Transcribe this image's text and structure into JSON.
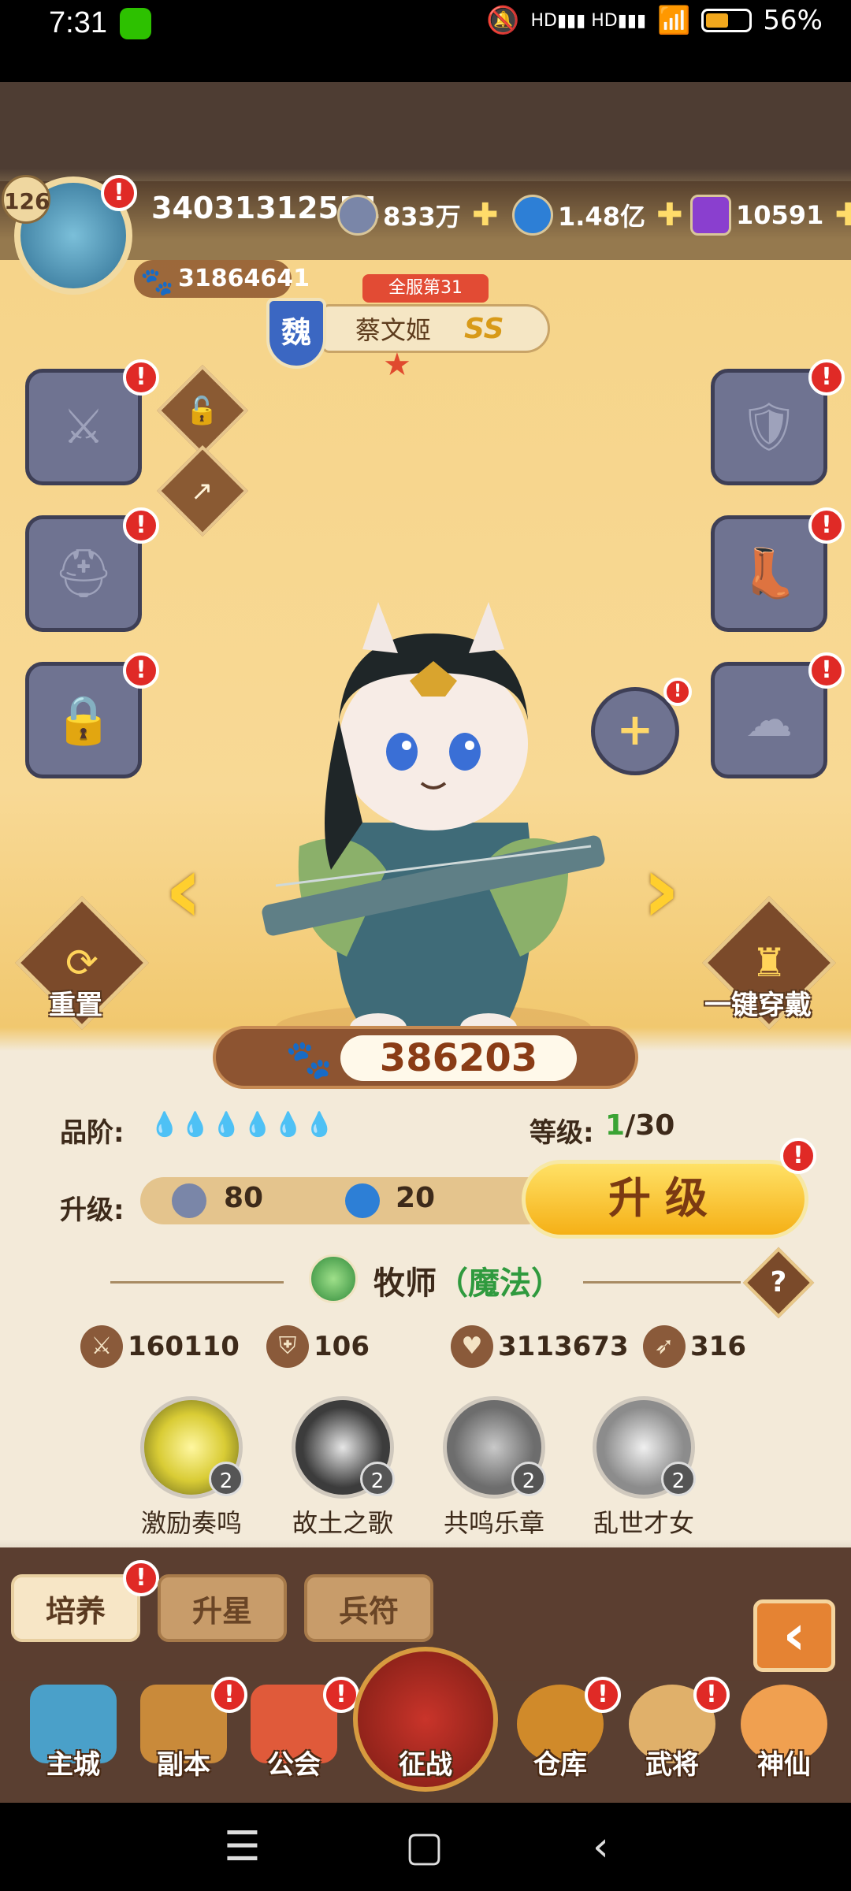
{
  "status_bar": {
    "time": "7:31",
    "battery": "56%",
    "signal": "HD▮▮▮ HD▮▮▮"
  },
  "player": {
    "level": "126",
    "id": "34031312551",
    "power": "31864641"
  },
  "resources": [
    {
      "name": "coin",
      "value": "833万",
      "color": "#7a86a8"
    },
    {
      "name": "gem",
      "value": "1.48亿",
      "color": "#2d7fd6"
    },
    {
      "name": "crystal",
      "value": "10591",
      "color": "#8a3fcf"
    }
  ],
  "hero": {
    "rank": "全服第31",
    "faction": "魏",
    "name": "蔡文姬",
    "grade": "SS",
    "power": "386203"
  },
  "actions": {
    "reset": "重置",
    "equip_all": "一键穿戴"
  },
  "stats_panel": {
    "quality_label": "品阶:",
    "quality_drops": "💧💧💧💧💧💧",
    "level_label": "等级:",
    "level_current": "1",
    "level_max": "/30",
    "upgrade_label": "升级:",
    "cost_coin": "80",
    "cost_gem": "20",
    "upgrade_button": "升级"
  },
  "class": {
    "name": "牧师",
    "type": "（魔法）"
  },
  "stats": [
    {
      "icon": "sword-icon",
      "glyph": "⚔",
      "value": "160110"
    },
    {
      "icon": "shield-icon",
      "glyph": "⛨",
      "value": "106"
    },
    {
      "icon": "heart-icon",
      "glyph": "♥",
      "value": "3113673"
    },
    {
      "icon": "boot-icon",
      "glyph": "➶",
      "value": "316"
    }
  ],
  "skills": [
    {
      "name": "激励奏鸣",
      "level": "2",
      "color": "#d9cc35"
    },
    {
      "name": "故土之歌",
      "level": "2",
      "color": "#3c3c3c"
    },
    {
      "name": "共鸣乐章",
      "level": "2",
      "color": "#6d6d6d"
    },
    {
      "name": "乱世才女",
      "level": "2",
      "color": "#8c8c8c"
    }
  ],
  "tabs": [
    "培养",
    "升星",
    "兵符"
  ],
  "nav": [
    "主城",
    "副本",
    "公会",
    "征战",
    "仓库",
    "武将",
    "神仙"
  ],
  "alert_mark": "!"
}
